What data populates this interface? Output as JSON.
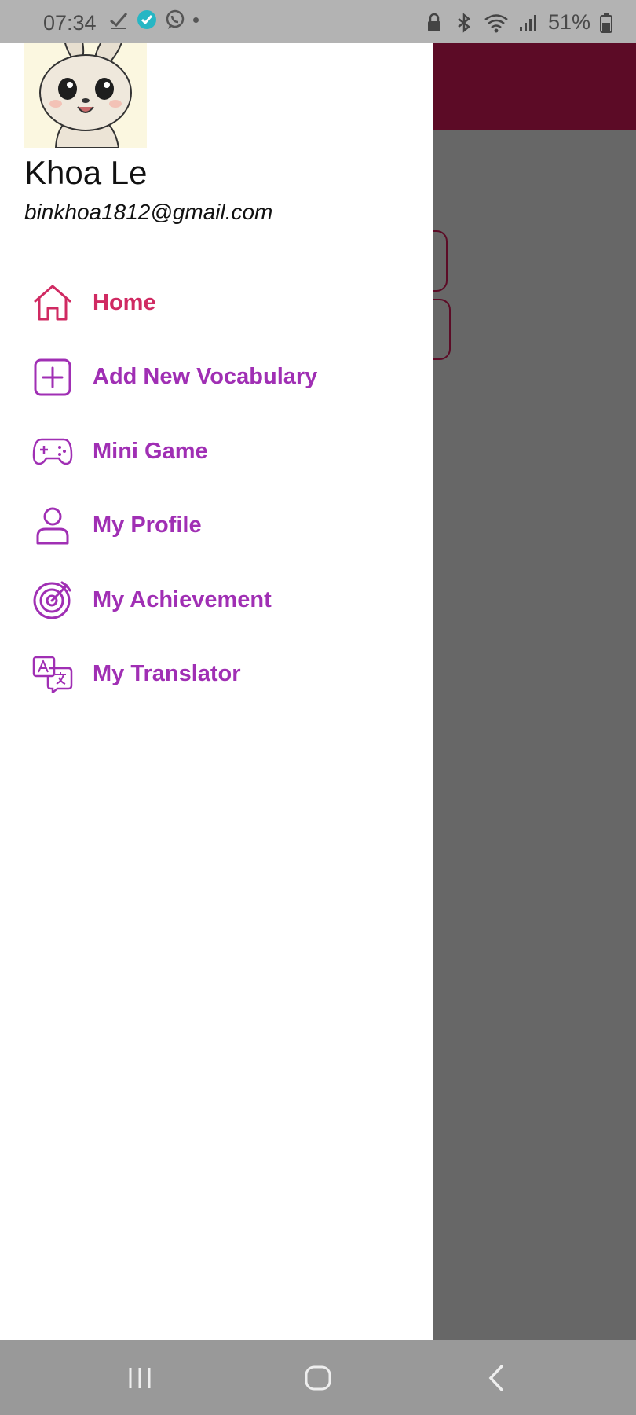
{
  "status_bar": {
    "time": "07:34",
    "battery": "51%",
    "icons_left": [
      "checkmark-icon",
      "app-badge-icon",
      "viber-icon",
      "dot-icon"
    ],
    "icons_right": [
      "lock-icon",
      "bluetooth-icon",
      "wifi-icon",
      "signal-icon",
      "battery-icon"
    ]
  },
  "drawer": {
    "user": {
      "name": "Khoa Le",
      "email": "binkhoa1812@gmail.com",
      "avatar": "bunny-avatar"
    },
    "menu": [
      {
        "label": "Home",
        "icon": "home-icon",
        "active": true
      },
      {
        "label": "Add New Vocabulary",
        "icon": "plus-square-icon",
        "active": false
      },
      {
        "label": "Mini Game",
        "icon": "gamepad-icon",
        "active": false
      },
      {
        "label": "My Profile",
        "icon": "person-icon",
        "active": false
      },
      {
        "label": "My Achievement",
        "icon": "target-icon",
        "active": false
      },
      {
        "label": "My Translator",
        "icon": "translate-icon",
        "active": false
      }
    ]
  },
  "colors": {
    "active": "#d02a62",
    "menu_text": "#a02fb4",
    "appbar": "#5c0b26",
    "scrim": "#676767"
  },
  "nav_bar": {
    "buttons": [
      "recents-button",
      "home-button",
      "back-button"
    ]
  }
}
